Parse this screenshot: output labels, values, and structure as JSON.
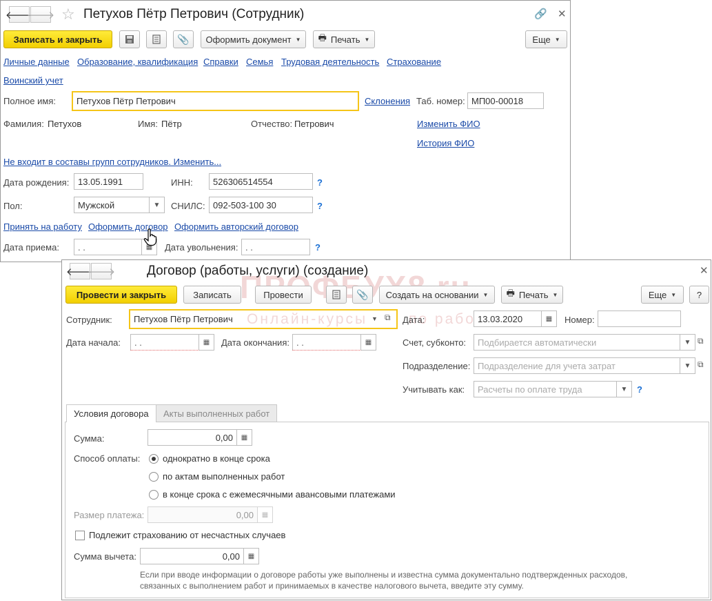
{
  "employee": {
    "title": "Петухов Пётр Петрович (Сотрудник)",
    "save_close": "Записать и закрыть",
    "create_doc": "Оформить документ",
    "print": "Печать",
    "more": "Еще",
    "tabs": [
      "Личные данные",
      "Образование, квалификация",
      "Справки",
      "Семья",
      "Трудовая деятельность",
      "Страхование",
      "Воинский учет"
    ],
    "full_name_label": "Полное имя:",
    "full_name_value": "Петухов Пётр Петрович",
    "declensions": "Склонения",
    "tab_no_label": "Таб. номер:",
    "tab_no_value": "МП00-00018",
    "surname_label": "Фамилия:",
    "surname_value": "Петухов",
    "name_label": "Имя:",
    "name_value": "Пётр",
    "patronymic_label": "Отчество:",
    "patronymic_value": "Петрович",
    "change_fio": "Изменить ФИО",
    "history_fio": "История ФИО",
    "groups_link": "Не входит в составы групп сотрудников. Изменить...",
    "birth_label": "Дата рождения:",
    "birth_value": "13.05.1991",
    "inn_label": "ИНН:",
    "inn_value": "526306514554",
    "sex_label": "Пол:",
    "sex_value": "Мужской",
    "snils_label": "СНИЛС:",
    "snils_value": "092-503-100 30",
    "hire_link": "Принять на работу",
    "contract_link": "Оформить договор",
    "author_contract_link": "Оформить авторский договор",
    "hire_date_label": "Дата приема:",
    "hire_date_value": " .  .",
    "dismiss_label": "Дата увольнения:",
    "dismiss_value": " .  .",
    "q": "?"
  },
  "contract": {
    "title": "Договор (работы, услуги) (создание)",
    "post_close": "Провести и закрыть",
    "save": "Записать",
    "post": "Провести",
    "create_based": "Создать на основании",
    "print": "Печать",
    "more": "Еще",
    "help": "?",
    "employee_label": "Сотрудник:",
    "employee_value": "Петухов Пётр Петрович",
    "date_label": "Дата:",
    "date_value": "13.03.2020",
    "number_label": "Номер:",
    "number_value": "",
    "start_label": "Дата начала:",
    "start_value": " .  .",
    "end_label": "Дата окончания:",
    "end_value": " .  .",
    "account_label": "Счет, субконто:",
    "account_placeholder": "Подбирается автоматически",
    "dept_label": "Подразделение:",
    "dept_placeholder": "Подразделение для учета затрат",
    "account_as_label": "Учитывать как:",
    "account_as_placeholder": "Расчеты по оплате труда",
    "tab_conditions": "Условия договора",
    "tab_acts": "Акты выполненных работ",
    "sum_label": "Сумма:",
    "sum_value": "0,00",
    "payment_label": "Способ оплаты:",
    "payment_options": [
      "однократно в конце срока",
      "по актам выполненных работ",
      "в конце срока с ежемесячными авансовыми платежами"
    ],
    "payment_size_label": "Размер платежа:",
    "payment_size_value": "0,00",
    "insurance_label": "Подлежит страхованию от несчастных случаев",
    "deduction_label": "Сумма вычета:",
    "deduction_value": "0,00",
    "hint": "Если при вводе информации о договоре работы уже выполнены и известна сумма документально подтвержденных расходов, связанных с выполнением работ и принимаемых в качестве налогового вычета, введите эту сумму."
  },
  "watermark": {
    "brand": "ПРОФБУХ8.ru",
    "sub1": "Онлайн-курсы",
    "sub2": "по работе в 1С"
  }
}
